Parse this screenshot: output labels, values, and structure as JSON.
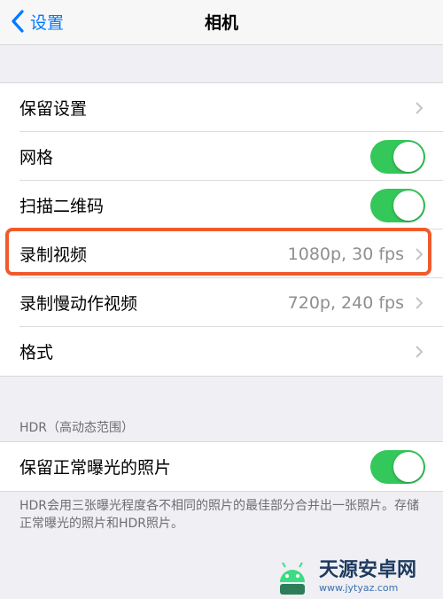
{
  "navbar": {
    "back_label": "设置",
    "title": "相机"
  },
  "main_group": {
    "rows": [
      {
        "label": "保留设置"
      },
      {
        "label": "网格",
        "toggle": "on"
      },
      {
        "label": "扫描二维码",
        "toggle": "on"
      },
      {
        "label": "录制视频",
        "value": "1080p, 30 fps"
      },
      {
        "label": "录制慢动作视频",
        "value": "720p, 240 fps"
      },
      {
        "label": "格式"
      }
    ]
  },
  "hdr_section": {
    "header": "HDR（高动态范围）",
    "row_label": "保留正常曝光的照片",
    "toggle": "on",
    "footer": "HDR会用三张曝光程度各不相同的照片的最佳部分合并出一张照片。存储正常曝光的照片和HDR照片。"
  },
  "watermark": {
    "name": "天源安卓网",
    "url": "www.jytyaz.com"
  },
  "colors": {
    "accent": "#007aff",
    "toggle_on": "#34c759",
    "highlight": "#f05a2c"
  }
}
